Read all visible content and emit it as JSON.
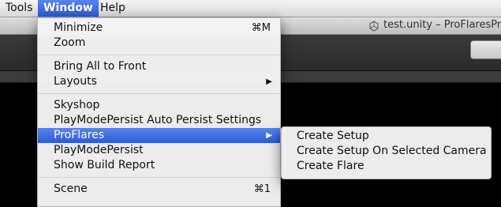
{
  "menubar": {
    "items": [
      "Tools",
      "Window",
      "Help"
    ]
  },
  "window_title": "test.unity – ProFlaresPro",
  "window_menu": {
    "items": [
      {
        "label": "Minimize",
        "shortcut": "⌘M"
      },
      {
        "label": "Zoom"
      },
      {
        "label": "Bring All to Front"
      },
      {
        "label": "Layouts",
        "submenu": true
      },
      {
        "label": "Skyshop"
      },
      {
        "label": "PlayModePersist Auto Persist Settings"
      },
      {
        "label": "ProFlares",
        "submenu": true,
        "selected": true
      },
      {
        "label": "PlayModePersist"
      },
      {
        "label": "Show Build Report"
      },
      {
        "label": "Scene",
        "shortcut": "⌘1"
      }
    ]
  },
  "proflares_submenu": {
    "items": [
      "Create Setup",
      "Create Setup On Selected Camera",
      "Create Flare"
    ]
  },
  "icons": {
    "document": "unity-document-icon",
    "submenu_arrow": "▶"
  }
}
